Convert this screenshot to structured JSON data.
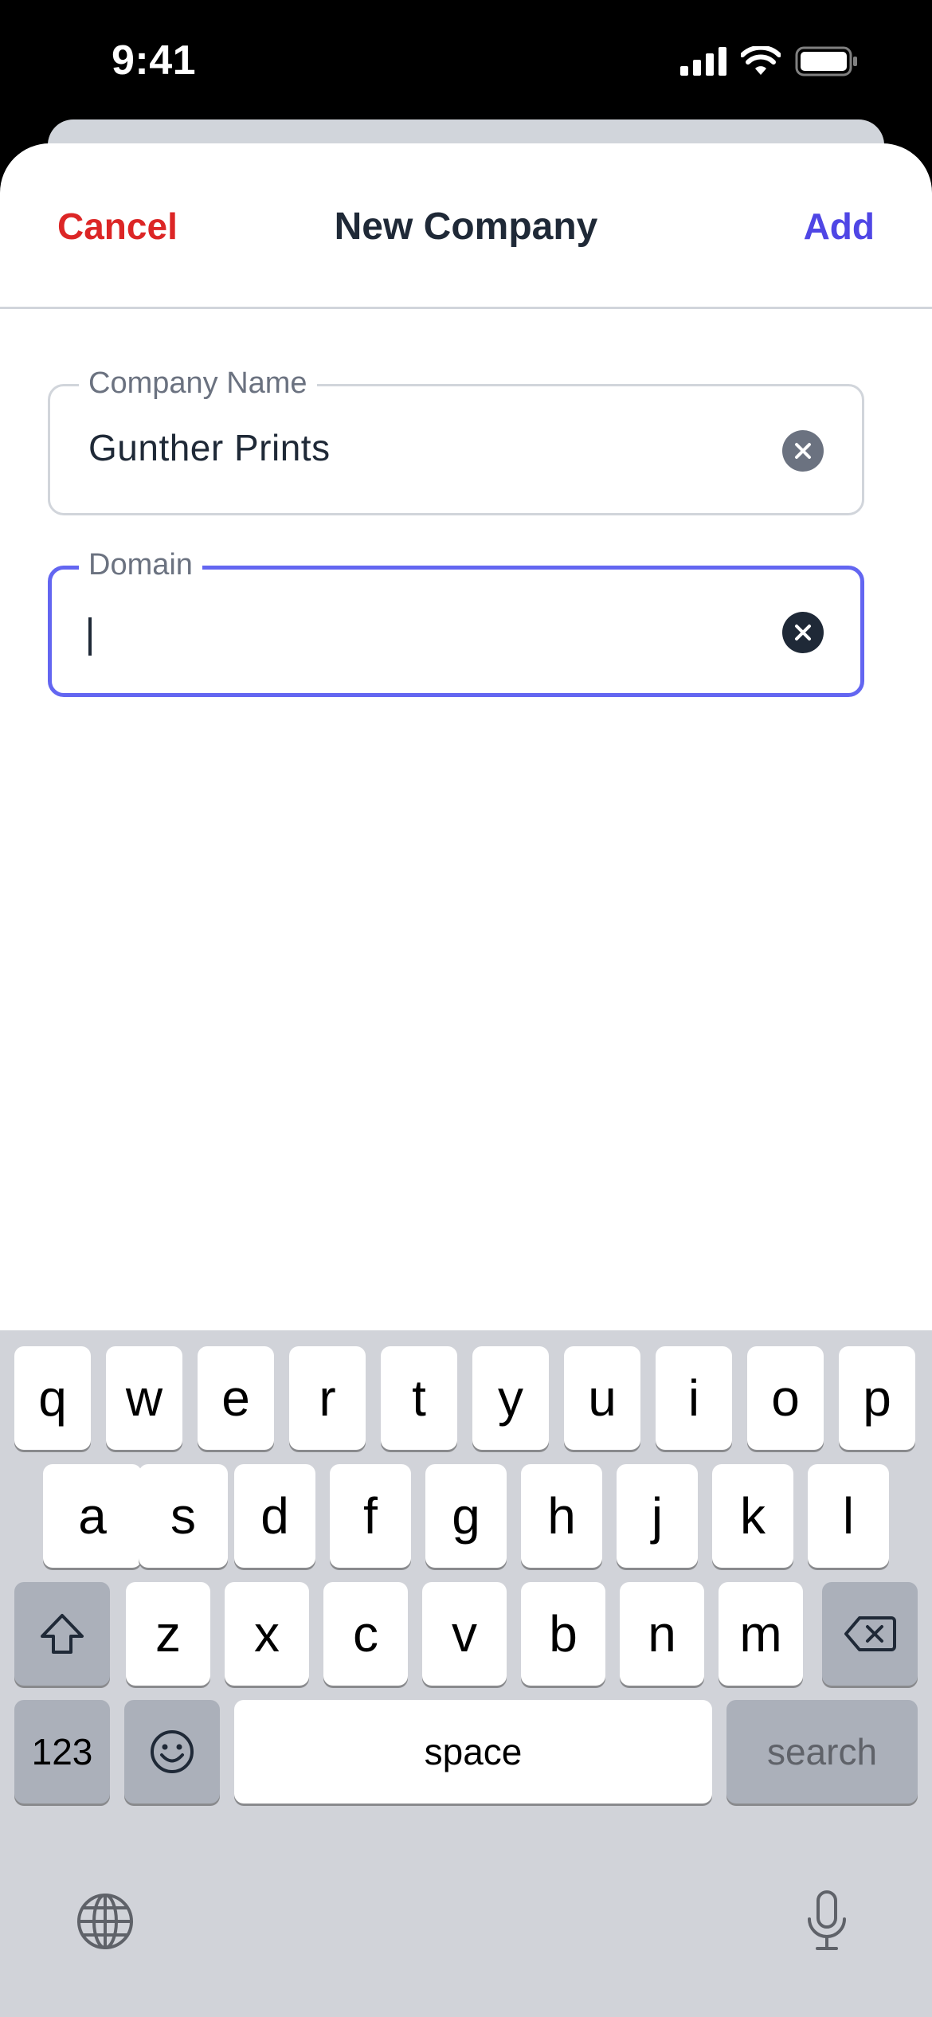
{
  "status_bar": {
    "time": "9:41"
  },
  "nav": {
    "cancel": "Cancel",
    "title": "New Company",
    "add": "Add"
  },
  "fields": [
    {
      "label": "Company Name",
      "value": "Gunther Prints",
      "focused": false
    },
    {
      "label": "Domain",
      "value": "",
      "focused": true
    }
  ],
  "keyboard": {
    "row1": [
      "q",
      "w",
      "e",
      "r",
      "t",
      "y",
      "u",
      "i",
      "o",
      "p"
    ],
    "row2": [
      "a",
      "s",
      "d",
      "f",
      "g",
      "h",
      "j",
      "k",
      "l"
    ],
    "row3": [
      "z",
      "x",
      "c",
      "v",
      "b",
      "n",
      "m"
    ],
    "numbers_key": "123",
    "space_key": "space",
    "search_key": "search"
  },
  "colors": {
    "cancel": "#dc2626",
    "add": "#4f46e5",
    "focus_border": "#6366f1"
  },
  "icons": [
    "cellular-signal-icon",
    "wifi-icon",
    "battery-icon",
    "clear-icon",
    "shift-icon",
    "backspace-icon",
    "emoji-icon",
    "globe-icon",
    "microphone-icon"
  ]
}
